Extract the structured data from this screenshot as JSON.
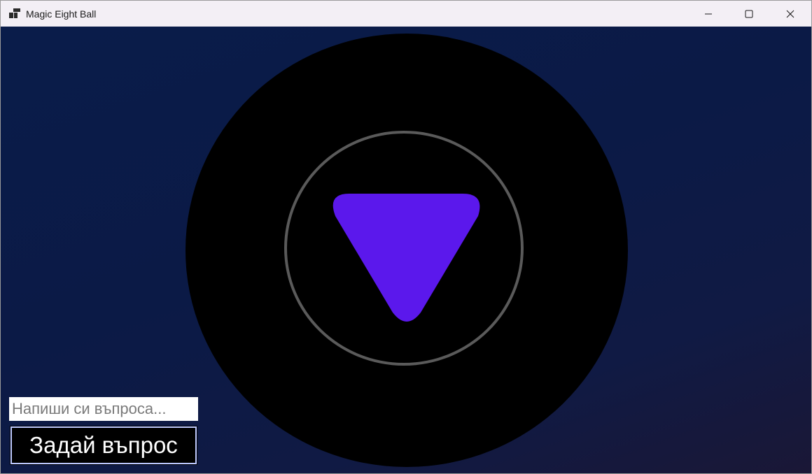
{
  "window": {
    "title": "Magic Eight Ball",
    "app_icon": "app-icon",
    "controls": [
      "minimize-icon",
      "maximize-icon",
      "close-icon"
    ]
  },
  "ball": {
    "ball_color": "#000000",
    "ring_color": "#5a5a5a",
    "triangle_color": "#5b18ec",
    "answer_text": ""
  },
  "form": {
    "input_value": "",
    "input_placeholder": "Напиши си въпроса...",
    "button_label": "Задай въпрос"
  },
  "colors": {
    "background_top": "#0a1c4a",
    "background_bottom": "#1a1736",
    "titlebar": "#f3eff5"
  }
}
